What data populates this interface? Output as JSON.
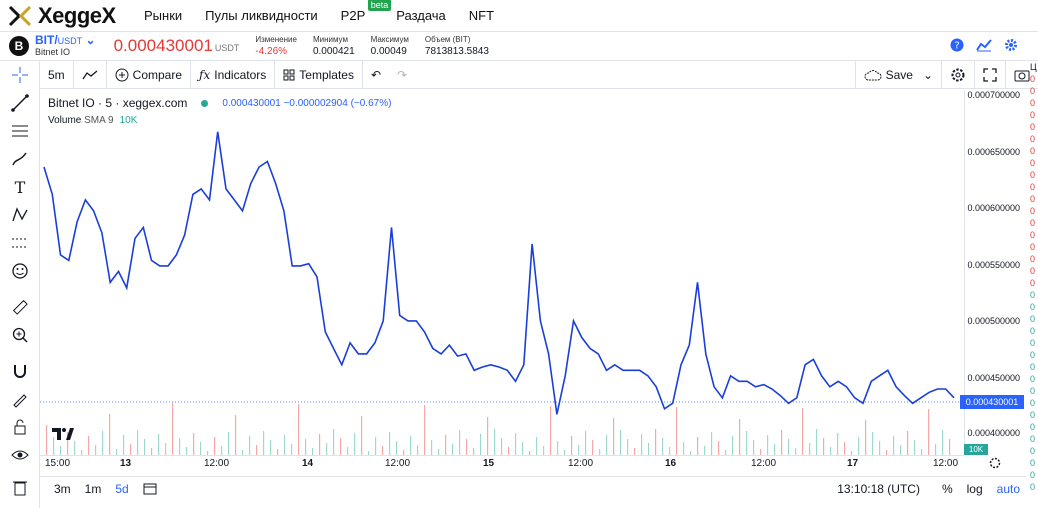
{
  "nav": {
    "logo": "XeggeX",
    "items": [
      "Рынки",
      "Пулы ликвидности",
      "P2P",
      "Раздача",
      "NFT"
    ],
    "beta_badge": "beta"
  },
  "ticker": {
    "coin_glyph": "B",
    "pair": "BIT/",
    "quote": "USDT",
    "name": "Bitnet IO",
    "price": "0.000430001",
    "price_unit": "USDT",
    "change_label": "Изменение",
    "change_value": "-4.26%",
    "min_label": "Минимум",
    "min_value": "0.000421",
    "max_label": "Максимум",
    "max_value": "0.00049",
    "vol_label": "Объем (BIT)",
    "vol_value": "7813813.5843"
  },
  "toolbar": {
    "interval": "5m",
    "compare": "Compare",
    "indicators": "Indicators",
    "templates": "Templates",
    "save": "Save"
  },
  "legend": {
    "title": "Bitnet IO · 5 · xeggex.com",
    "ohlc": "0.000430001 −0.000002904 (−0.67%)",
    "volume_label": "Volume",
    "sma": "SMA 9",
    "volume_value": "10K"
  },
  "price_axis": {
    "labels": [
      "0.000700000",
      "0.000650000",
      "0.000600000",
      "0.000550000",
      "0.000500000",
      "0.000450000",
      "0.000400000"
    ],
    "current": "0.000430001",
    "volume_tag": "10K"
  },
  "time_axis": {
    "labels": [
      "15:00",
      "13",
      "12:00",
      "14",
      "12:00",
      "15",
      "12:00",
      "16",
      "12:00",
      "17",
      "12:00"
    ]
  },
  "bottombar": {
    "ranges": [
      "3m",
      "1m",
      "5d"
    ],
    "active_range": "5d",
    "clock": "13:10:18 (UTC)",
    "percent": "%",
    "log": "log",
    "auto": "auto"
  },
  "orderbook_strip": {
    "header": "Ц"
  },
  "colors": {
    "line": "#1a3fd8",
    "accent": "#2962ff",
    "down": "#e53935",
    "up": "#26a69a"
  },
  "chart_data": {
    "type": "line",
    "ylim": [
      0.000378,
      0.00071
    ],
    "x_labels": [
      "15:00",
      "13",
      "12:00",
      "14",
      "12:00",
      "15",
      "12:00",
      "16",
      "12:00",
      "17",
      "12:00"
    ],
    "values": [
      0.00064,
      0.000615,
      0.00056,
      0.000555,
      0.00059,
      0.00061,
      0.0006,
      0.00058,
      0.000535,
      0.000545,
      0.00053,
      0.000575,
      0.000585,
      0.000555,
      0.00055,
      0.00055,
      0.00056,
      0.000578,
      0.000615,
      0.00062,
      0.00061,
      0.000672,
      0.00062,
      0.00061,
      0.0006,
      0.000625,
      0.00064,
      0.000645,
      0.000625,
      0.0006,
      0.00055,
      0.00055,
      0.000552,
      0.00054,
      0.00049,
      0.000475,
      0.00046,
      0.00048,
      0.00047,
      0.00047,
      0.00048,
      0.0005,
      0.000585,
      0.000505,
      0.0005,
      0.0005,
      0.00049,
      0.000475,
      0.00047,
      0.000478,
      0.000468,
      0.00047,
      0.000455,
      0.000458,
      0.00046,
      0.000458,
      0.000455,
      0.000445,
      0.00046,
      0.00057,
      0.0005,
      0.00047,
      0.000415,
      0.00045,
      0.0005,
      0.000485,
      0.000475,
      0.00047,
      0.000455,
      0.00046,
      0.000455,
      0.000455,
      0.000455,
      0.00045,
      0.00044,
      0.00042,
      0.000425,
      0.00046,
      0.000478,
      0.000535,
      0.00047,
      0.00044,
      0.00043,
      0.00045,
      0.000445,
      0.000445,
      0.00044,
      0.000442,
      0.000438,
      0.000432,
      0.000425,
      0.00043,
      0.00046,
      0.000465,
      0.00045,
      0.00044,
      0.000445,
      0.00044,
      0.00043,
      0.000425,
      0.000445,
      0.00045,
      0.000455,
      0.00044,
      0.000432,
      0.000425,
      0.00043,
      0.000435,
      0.000438,
      0.000438,
      0.00043
    ]
  }
}
